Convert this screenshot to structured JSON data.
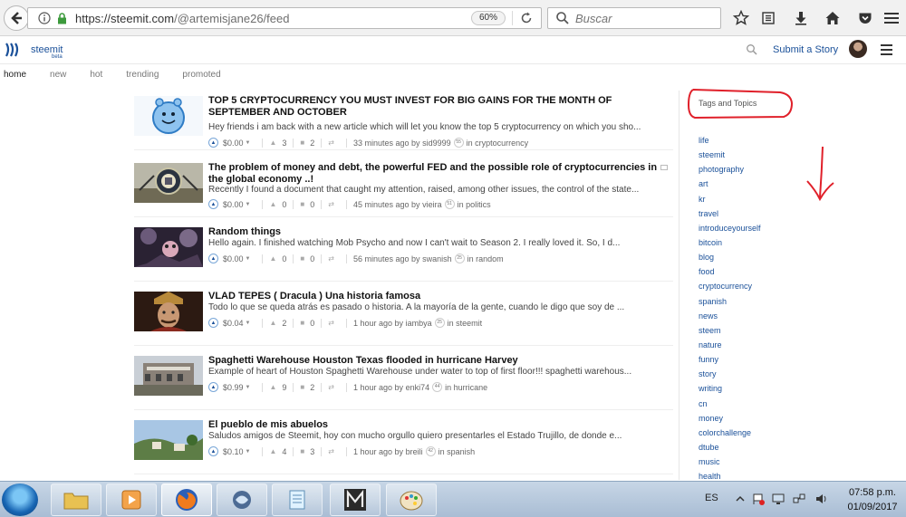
{
  "browser": {
    "url_host": "https://steemit.com",
    "url_path": "/@artemisjane26/feed",
    "zoom": "60%",
    "search_placeholder": "Buscar"
  },
  "header": {
    "brand": "steemit",
    "beta": "beta",
    "submit_label": "Submit a Story"
  },
  "subnav": [
    "home",
    "new",
    "hot",
    "trending",
    "promoted"
  ],
  "posts": [
    {
      "title": "TOP 5 CRYPTOCURRENCY YOU MUST INVEST FOR BIG GAINS FOR THE MONTH OF SEPTEMBER AND OCTOBER",
      "body": "Hey friends i am back with a new article which will let you know the top 5 cryptocurrency on which you sho...",
      "payout": "$0.00",
      "votes": "3",
      "comments": "2",
      "time": "33 minutes ago",
      "by": "by",
      "author": "sid9999",
      "rep": "55",
      "in": "in",
      "category": "cryptocurrency"
    },
    {
      "title": "The problem of money and debt, the powerful FED and the possible role of cryptocurrencies in the global economy ..!",
      "body": "Recently I found a document that caught my attention, raised, among other issues, the control of the state...",
      "payout": "$0.00",
      "votes": "0",
      "comments": "0",
      "time": "45 minutes ago",
      "by": "by",
      "author": "vieira",
      "rep": "51",
      "in": "in",
      "category": "politics"
    },
    {
      "title": "Random things",
      "body": "Hello again. I finished watching Mob Psycho and now I can't wait to Season 2. I really loved it.  So, I d...",
      "payout": "$0.00",
      "votes": "0",
      "comments": "0",
      "time": "56 minutes ago",
      "by": "by",
      "author": "swanish",
      "rep": "25",
      "in": "in",
      "category": "random"
    },
    {
      "title": "VLAD TEPES ( Dracula ) Una historia famosa",
      "body": "Todo lo que se queda atrás es pasado o historia. A la mayoría de la gente, cuando le digo que soy de ...",
      "payout": "$0.04",
      "votes": "2",
      "comments": "0",
      "time": "1 hour ago",
      "by": "by",
      "author": "iambya",
      "rep": "25",
      "in": "in",
      "category": "steemit"
    },
    {
      "title": "Spaghetti Warehouse Houston Texas flooded in hurricane Harvey",
      "body": "Example of heart of Houston Spaghetti Warehouse under water to top of first floor!!! spaghetti warehous...",
      "payout": "$0.99",
      "votes": "9",
      "comments": "2",
      "time": "1 hour ago",
      "by": "by",
      "author": "enki74",
      "rep": "44",
      "in": "in",
      "category": "hurricane"
    },
    {
      "title": "El pueblo de mis abuelos",
      "body": "Saludos amigos de Steemit, hoy con mucho orgullo quiero presentarles el Estado Trujillo, de donde e...",
      "payout": "$0.10",
      "votes": "4",
      "comments": "3",
      "time": "1 hour ago",
      "by": "by",
      "author": "breili",
      "rep": "42",
      "in": "in",
      "category": "spanish"
    }
  ],
  "sidebar": {
    "title": "Tags and Topics",
    "tags": [
      "life",
      "steemit",
      "photography",
      "art",
      "kr",
      "travel",
      "introduceyourself",
      "bitcoin",
      "blog",
      "food",
      "cryptocurrency",
      "spanish",
      "news",
      "steem",
      "nature",
      "funny",
      "story",
      "writing",
      "cn",
      "money",
      "colorchallenge",
      "dtube",
      "music",
      "health"
    ]
  },
  "taskbar": {
    "lang": "ES",
    "time": "07:58 p.m.",
    "date": "01/09/2017"
  },
  "colors": {
    "link": "#1a5099",
    "annotation_red": "#e0202a"
  }
}
